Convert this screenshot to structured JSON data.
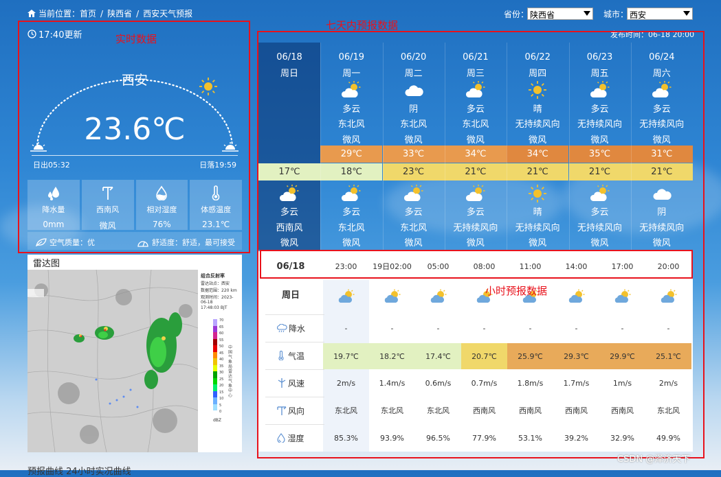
{
  "breadcrumb": {
    "prefix": "当前位置：",
    "items": [
      "首页",
      "陕西省",
      "西安天气预报"
    ]
  },
  "selectors": {
    "province_label": "省份：",
    "province_value": "陕西省",
    "city_label": "城市：",
    "city_value": "西安"
  },
  "publish_time": "发布时间：06-18 20:00",
  "annotations": {
    "realtime": "实时数据",
    "daily": "七天内预报数据",
    "hourly": "小时预报数据"
  },
  "realtime": {
    "update_time": "17:40更新",
    "city": "西安",
    "temperature": "23.6℃",
    "sunrise": "日出05:32",
    "sunset": "日落19:59",
    "cards": [
      {
        "label": "降水量",
        "value": "0mm",
        "icon": "raindrops-icon"
      },
      {
        "label": "西南风",
        "value": "微风",
        "icon": "wind-vane-icon"
      },
      {
        "label": "相对湿度",
        "value": "76%",
        "icon": "humidity-drop-icon"
      },
      {
        "label": "体感温度",
        "value": "23.1℃",
        "icon": "thermometer-icon"
      }
    ],
    "air_quality": "空气质量：优",
    "comfort": "舒适度：舒适，最可接受"
  },
  "radar": {
    "title": "雷达图",
    "legend_title": "组合反射率",
    "legend_lines": [
      "雷达站点：西安",
      "数据范围：220 km",
      "观测时间：2023-06-18",
      "17:48:03 BJT"
    ],
    "legend_values": [
      "70",
      "65",
      "60",
      "55",
      "50",
      "45",
      "40",
      "35",
      "30",
      "25",
      "20",
      "15",
      "10",
      "5",
      "0"
    ],
    "legend_unit": "dBZ",
    "legend_org": "中国气象局雷达气象中心"
  },
  "bottom_hint": "预报曲线 24小时实况曲线",
  "daily": [
    {
      "date": "06/18",
      "week": "周日",
      "day_weather": "",
      "day_wind_dir": "",
      "day_wind_level": "",
      "high": "",
      "low": "17℃",
      "night_weather": "多云",
      "night_wind_dir": "西南风",
      "night_wind_level": "微风",
      "day_icon": "",
      "night_icon": "partly-cloudy-icon"
    },
    {
      "date": "06/19",
      "week": "周一",
      "day_weather": "多云",
      "day_wind_dir": "东北风",
      "day_wind_level": "微风",
      "high": "29℃",
      "low": "18℃",
      "night_weather": "多云",
      "night_wind_dir": "东北风",
      "night_wind_level": "微风",
      "day_icon": "partly-cloudy-icon",
      "night_icon": "partly-cloudy-icon"
    },
    {
      "date": "06/20",
      "week": "周二",
      "day_weather": "阴",
      "day_wind_dir": "东北风",
      "day_wind_level": "微风",
      "high": "33℃",
      "low": "23℃",
      "night_weather": "多云",
      "night_wind_dir": "东北风",
      "night_wind_level": "微风",
      "day_icon": "cloud-icon",
      "night_icon": "partly-cloudy-icon"
    },
    {
      "date": "06/21",
      "week": "周三",
      "day_weather": "多云",
      "day_wind_dir": "东北风",
      "day_wind_level": "微风",
      "high": "34℃",
      "low": "21℃",
      "night_weather": "多云",
      "night_wind_dir": "无持续风向",
      "night_wind_level": "微风",
      "day_icon": "partly-cloudy-icon",
      "night_icon": "partly-cloudy-icon"
    },
    {
      "date": "06/22",
      "week": "周四",
      "day_weather": "晴",
      "day_wind_dir": "无持续风向",
      "day_wind_level": "微风",
      "high": "34℃",
      "low": "21℃",
      "night_weather": "晴",
      "night_wind_dir": "无持续风向",
      "night_wind_level": "微风",
      "day_icon": "sun-icon",
      "night_icon": "sun-icon"
    },
    {
      "date": "06/23",
      "week": "周五",
      "day_weather": "多云",
      "day_wind_dir": "无持续风向",
      "day_wind_level": "微风",
      "high": "35℃",
      "low": "21℃",
      "night_weather": "多云",
      "night_wind_dir": "无持续风向",
      "night_wind_level": "微风",
      "day_icon": "partly-cloudy-icon",
      "night_icon": "partly-cloudy-icon"
    },
    {
      "date": "06/24",
      "week": "周六",
      "day_weather": "多云",
      "day_wind_dir": "无持续风向",
      "day_wind_level": "微风",
      "high": "31℃",
      "low": "21℃",
      "night_weather": "阴",
      "night_wind_dir": "无持续风向",
      "night_wind_level": "微风",
      "day_icon": "partly-cloudy-icon",
      "night_icon": "cloud-icon"
    }
  ],
  "hourly": {
    "date": "06/18",
    "weekday": "周日",
    "times": [
      "23:00",
      "19日02:00",
      "05:00",
      "08:00",
      "11:00",
      "14:00",
      "17:00",
      "20:00"
    ],
    "labels": {
      "precip": "降水",
      "temp": "气温",
      "wind_speed": "风速",
      "wind_dir": "风向",
      "humidity": "湿度"
    },
    "precip": [
      "-",
      "-",
      "-",
      "-",
      "-",
      "-",
      "-",
      "-"
    ],
    "temp": [
      "19.7℃",
      "18.2℃",
      "17.4℃",
      "20.7℃",
      "25.9℃",
      "29.3℃",
      "29.9℃",
      "25.1℃"
    ],
    "wind_speed": [
      "2m/s",
      "1.4m/s",
      "0.6m/s",
      "0.7m/s",
      "1.8m/s",
      "1.7m/s",
      "1m/s",
      "2m/s"
    ],
    "wind_dir": [
      "东北风",
      "东北风",
      "东北风",
      "西南风",
      "西南风",
      "西南风",
      "西南风",
      "东北风"
    ],
    "humidity": [
      "85.3%",
      "93.9%",
      "96.5%",
      "77.9%",
      "53.1%",
      "39.2%",
      "32.9%",
      "49.9%"
    ]
  },
  "watermark": "CSDN @泽济天下",
  "colors": {
    "high_warm": "#e89a4e",
    "high_hot": "#e0883f",
    "low_mild": "#e2f1c1",
    "low_warm": "#f0d86a",
    "annotation": "#e8121c"
  }
}
